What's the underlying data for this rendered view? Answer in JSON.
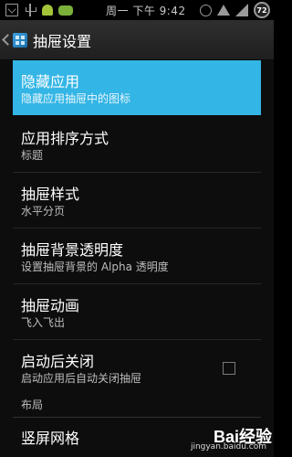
{
  "status_bar": {
    "clock": "周一 下午 9:42",
    "battery_level": "72",
    "icons": [
      "mail-icon",
      "usb-icon",
      "android-icon",
      "game-icon",
      "alarm-icon",
      "wifi-icon",
      "signal-icon",
      "battery-icon"
    ]
  },
  "action_bar": {
    "title": "抽屉设置"
  },
  "items": [
    {
      "title": "隐藏应用",
      "summary": "隐藏应用抽屉中的图标",
      "highlighted": true
    },
    {
      "title": "应用排序方式",
      "summary": "标题"
    },
    {
      "title": "抽屉样式",
      "summary": "水平分页"
    },
    {
      "title": "抽屉背景透明度",
      "summary": "设置抽屉背景的 Alpha 透明度"
    },
    {
      "title": "抽屉动画",
      "summary": "飞入飞出"
    },
    {
      "title": "启动后关闭",
      "summary": "启动应用后自动关闭抽屉",
      "checkbox": false
    }
  ],
  "section": {
    "title": "布局"
  },
  "layout_items": [
    {
      "title": "竖屏网格",
      "summary": ""
    }
  ],
  "watermark": {
    "brand": "Bai经验",
    "url": "jingyan.baidu.com"
  },
  "colors": {
    "highlight": "#33b5e5",
    "background": "#0d0d0d"
  }
}
